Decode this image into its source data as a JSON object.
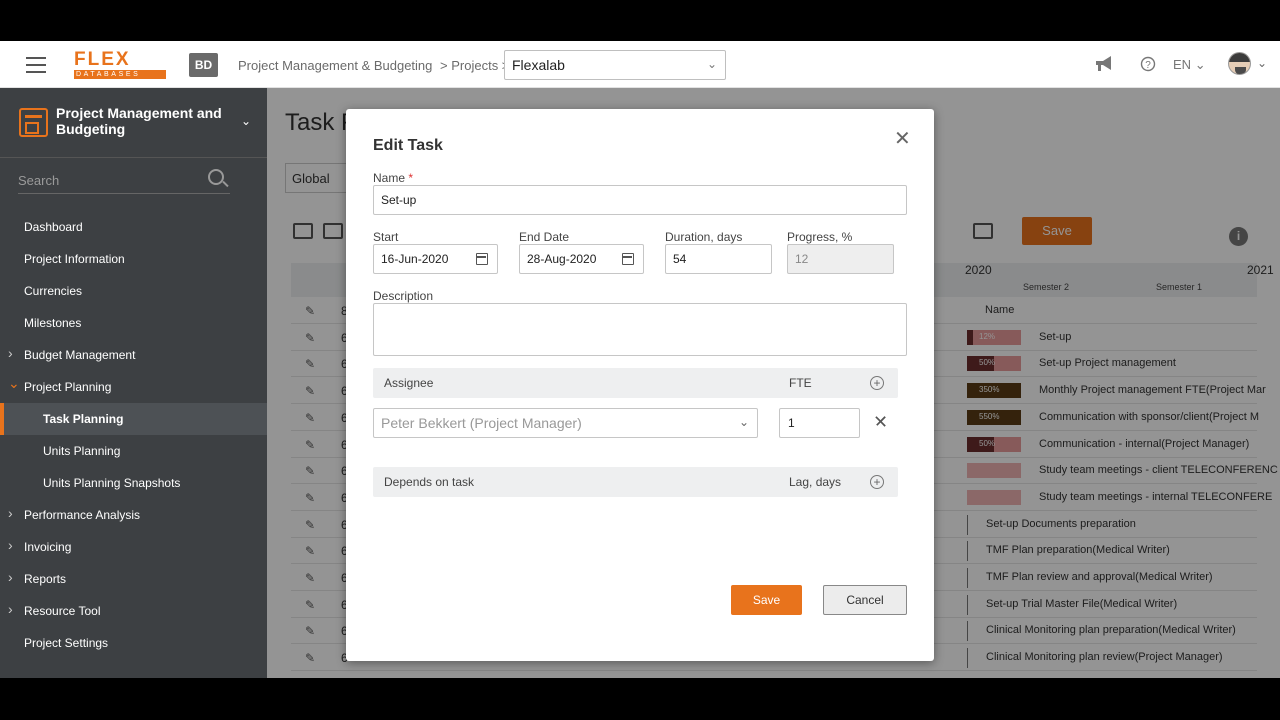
{
  "topbar": {
    "logo_top": "FLEX",
    "logo_bottom": "DATABASES",
    "badge": "BD",
    "breadcrumb": [
      "Project Management & Budgeting",
      "> Projects >"
    ],
    "project_select_value": "Flexalab",
    "language": "EN"
  },
  "sidebar": {
    "header_title": "Project Management and Budgeting",
    "search_placeholder": "Search",
    "items": [
      {
        "label": "Dashboard",
        "expandable": false
      },
      {
        "label": "Project Information",
        "expandable": false
      },
      {
        "label": "Currencies",
        "expandable": false
      },
      {
        "label": "Milestones",
        "expandable": false
      },
      {
        "label": "Budget Management",
        "expandable": true
      },
      {
        "label": "Project Planning",
        "expandable": true,
        "expanded": true
      },
      {
        "label": "Task Planning",
        "sub": true,
        "active": true
      },
      {
        "label": "Units Planning",
        "sub": true
      },
      {
        "label": "Units Planning Snapshots",
        "sub": true
      },
      {
        "label": "Performance Analysis",
        "expandable": true
      },
      {
        "label": "Invoicing",
        "expandable": true
      },
      {
        "label": "Reports",
        "expandable": true
      },
      {
        "label": "Resource Tool",
        "expandable": true
      },
      {
        "label": "Project Settings",
        "expandable": false
      }
    ]
  },
  "main": {
    "title": "Task P",
    "global_select": "Global",
    "save_label": "Save",
    "gantt_years": [
      "2020",
      "2021"
    ],
    "gantt_semesters": [
      "Semester 2",
      "Semester 1"
    ],
    "gantt_name_header": "Name",
    "rows": [
      {
        "num": "8",
        "bar": "",
        "label": "",
        "kind": "header"
      },
      {
        "num": "6",
        "bar": "12%",
        "progress": 0.12,
        "label": "Set-up",
        "kind": "red"
      },
      {
        "num": "6",
        "bar": "50%",
        "progress": 0.5,
        "label": "Set-up Project management",
        "kind": "red"
      },
      {
        "num": "6",
        "bar": "350%",
        "progress": 1,
        "label": "Monthly Project management FTE(Project Mar",
        "kind": "brown"
      },
      {
        "num": "6",
        "bar": "550%",
        "progress": 1,
        "label": "Communication with sponsor/client(Project M",
        "kind": "brown"
      },
      {
        "num": "6",
        "bar": "50%",
        "progress": 0.5,
        "label": "Communication - internal(Project Manager)",
        "kind": "red"
      },
      {
        "num": "6",
        "bar": "",
        "progress": 0,
        "label": "Study team meetings - client TELECONFERENC",
        "kind": "pale"
      },
      {
        "num": "6",
        "bar": "",
        "progress": 0,
        "label": "Study team meetings - internal TELECONFERE",
        "kind": "pale"
      },
      {
        "num": "6",
        "bar": "",
        "label": "Set-up Documents preparation",
        "kind": "tick"
      },
      {
        "num": "6",
        "bar": "",
        "label": "TMF Plan preparation(Medical Writer)",
        "kind": "tick"
      },
      {
        "num": "6",
        "bar": "",
        "label": "TMF Plan review and approval(Medical Writer)",
        "kind": "tick"
      },
      {
        "num": "6",
        "bar": "",
        "label": "Set-up Trial Master File(Medical Writer)",
        "kind": "tick"
      },
      {
        "num": "6",
        "bar": "",
        "label": "Clinical Monitoring plan preparation(Medical Writer)",
        "kind": "tick"
      },
      {
        "num": "6",
        "bar": "",
        "label": "Clinical Monitoring plan review(Project Manager)",
        "kind": "tick"
      }
    ]
  },
  "modal": {
    "title": "Edit Task",
    "name_label": "Name",
    "name_required": "*",
    "name_value": "Set-up",
    "start_label": "Start",
    "start_value": "16-Jun-2020",
    "end_label": "End Date",
    "end_value": "28-Aug-2020",
    "duration_label": "Duration, days",
    "duration_value": "54",
    "progress_label": "Progress, %",
    "progress_value": "12",
    "description_label": "Description",
    "description_value": "",
    "assignee_header": "Assignee",
    "fte_header": "FTE",
    "assignee_value": "Peter Bekkert (Project Manager)",
    "fte_value": "1",
    "depends_header": "Depends on task",
    "lag_header": "Lag, days",
    "save_label": "Save",
    "cancel_label": "Cancel"
  },
  "colors": {
    "accent": "#e8731c",
    "sidebar_bg": "#3d4043",
    "overlay": "rgba(0,0,0,0.42)"
  }
}
